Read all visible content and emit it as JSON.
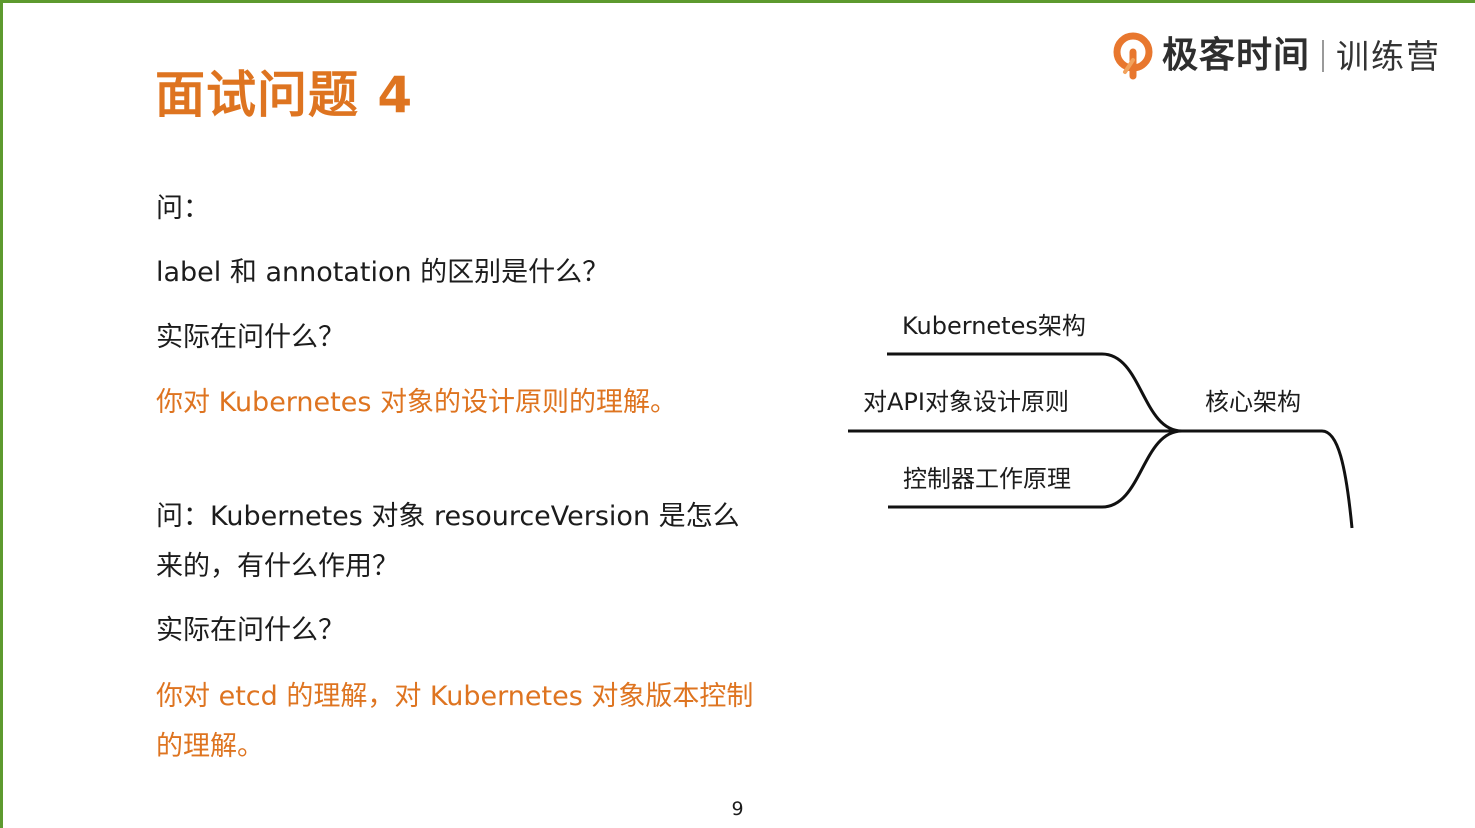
{
  "brand": {
    "name": "极客时间",
    "sub": "训练营",
    "logo_icon": "geektime-logo-icon",
    "logo_color": "#e8772e"
  },
  "slide": {
    "title": "面试问题 4",
    "title_color": "#de7420",
    "page_number": "9"
  },
  "content": {
    "q1_label": "问：",
    "q1_text": "label 和 annotation 的区别是什么？",
    "q1_ask": "实际在问什么？",
    "q1_answer": "你对 Kubernetes 对象的设计原则的理解。",
    "q2_text": "问：Kubernetes 对象 resourceVersion 是怎么来的，有什么作用？",
    "q2_ask": "实际在问什么？",
    "q2_answer": "你对 etcd 的理解，对 Kubernetes 对象版本控制的理解。"
  },
  "mindmap": {
    "center": "核心架构",
    "branches": [
      "Kubernetes架构",
      "对API对象设计原则",
      "控制器工作原理"
    ]
  }
}
